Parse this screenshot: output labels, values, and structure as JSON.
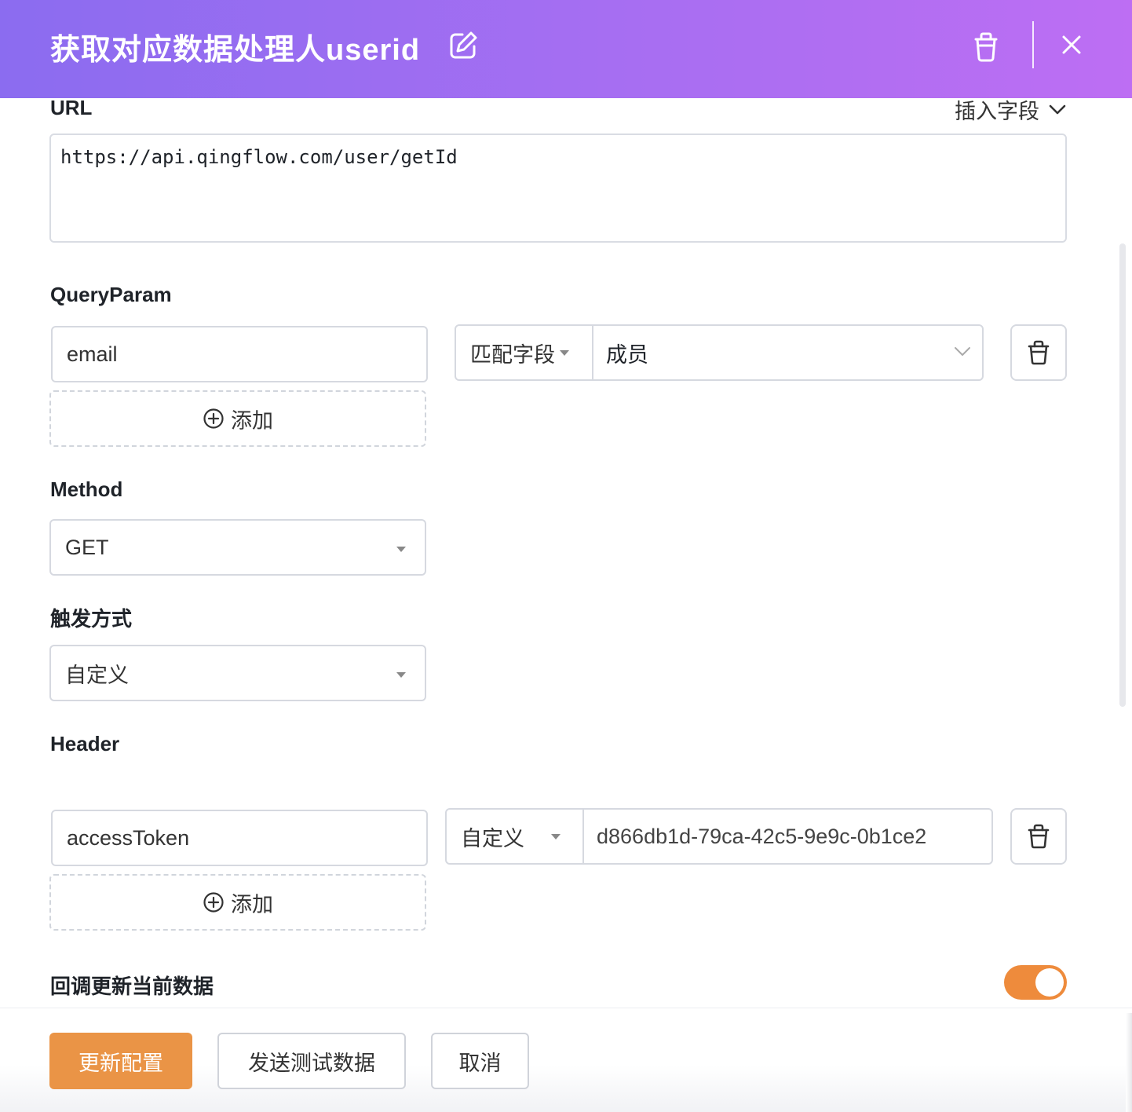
{
  "header": {
    "title": "获取对应数据处理人userid",
    "icons": [
      "edit-icon",
      "trash-icon",
      "close-icon"
    ]
  },
  "url_section": {
    "label": "URL",
    "insert_field": "插入字段",
    "value": "https://api.qingflow.com/user/getId"
  },
  "query_section": {
    "label": "QueryParam",
    "key": "email",
    "match_type": "匹配字段",
    "match_value": "成员",
    "add_label": "添加"
  },
  "method_section": {
    "label": "Method",
    "value": "GET"
  },
  "trigger_section": {
    "label": "触发方式",
    "value": "自定义"
  },
  "header_section": {
    "label": "Header",
    "key": "accessToken",
    "value_type": "自定义",
    "value": "d866db1d-79ca-42c5-9e9c-0b1ce2",
    "add_label": "添加"
  },
  "callback": {
    "label": "回调更新当前数据",
    "enabled": true
  },
  "footer": {
    "update_label": "更新配置",
    "test_label": "发送测试数据",
    "cancel_label": "取消"
  },
  "colors": {
    "header_gradient_start": "#8b6cf0",
    "header_gradient_end": "#bd6ef3",
    "primary": "#ea9446",
    "toggle_on": "#ee8b3c"
  }
}
